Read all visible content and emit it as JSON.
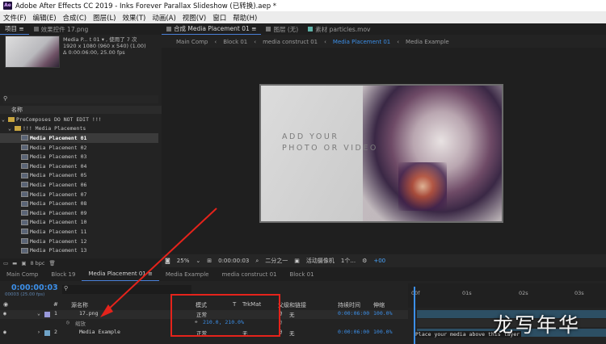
{
  "titlebar": {
    "logo": "Ae",
    "title": "Adobe After Effects CC 2019 - Inks Forever Parallax Slideshow (已转换).aep *"
  },
  "menu": [
    "文件(F)",
    "编辑(E)",
    "合成(C)",
    "图层(L)",
    "效果(T)",
    "动画(A)",
    "视图(V)",
    "窗口",
    "帮助(H)"
  ],
  "project": {
    "tabs": [
      "项目 ≡",
      "效果控件 17.png"
    ],
    "info": [
      "Media P... t 01 ▾ , 使用了 7 次",
      "1920 x 1080 (960 x 540) (1.00)",
      "Δ 0:00:06:00, 25.00 fps"
    ],
    "search": "⚲",
    "col_name": "名称",
    "items": [
      {
        "label": "PreComposes DO NOT EDIT !!!",
        "type": "folder",
        "indent": 0
      },
      {
        "label": "!!! Media Placements",
        "type": "folder",
        "indent": 1
      },
      {
        "label": "Media Placement 01",
        "type": "comp",
        "indent": 2,
        "selected": true
      },
      {
        "label": "Media Placement 02",
        "type": "comp",
        "indent": 2
      },
      {
        "label": "Media Placement 03",
        "type": "comp",
        "indent": 2
      },
      {
        "label": "Media Placement 04",
        "type": "comp",
        "indent": 2
      },
      {
        "label": "Media Placement 05",
        "type": "comp",
        "indent": 2
      },
      {
        "label": "Media Placement 06",
        "type": "comp",
        "indent": 2
      },
      {
        "label": "Media Placement 07",
        "type": "comp",
        "indent": 2
      },
      {
        "label": "Media Placement 08",
        "type": "comp",
        "indent": 2
      },
      {
        "label": "Media Placement 09",
        "type": "comp",
        "indent": 2
      },
      {
        "label": "Media Placement 10",
        "type": "comp",
        "indent": 2
      },
      {
        "label": "Media Placement 11",
        "type": "comp",
        "indent": 2
      },
      {
        "label": "Media Placement 12",
        "type": "comp",
        "indent": 2
      },
      {
        "label": "Media Placement 13",
        "type": "comp",
        "indent": 2
      }
    ],
    "bottom_depth": "8 bpc"
  },
  "composition": {
    "tabs": [
      "合成 Media Placement 01 ≡",
      "图层 (无)",
      "素材 particles.mov"
    ],
    "breadcrumbs": [
      "Main Comp",
      "Block 01",
      "media construct 01",
      "Media Placement 01",
      "Media Example"
    ],
    "placeholder_line1": "ADD YOUR",
    "placeholder_line2": "PHOTO OR VIDEO",
    "toolbar": {
      "zoom": "25%",
      "timecode": "0:00:00:03",
      "resolution": "二分之一",
      "camera": "活动摄像机",
      "views": "1个...",
      "offset": "+00"
    }
  },
  "timeline": {
    "tabs": [
      "Main Comp",
      "Block 19",
      "Media Placement 01 ≡",
      "Media Example",
      "media construct 01",
      "Block 01"
    ],
    "timecode": "0:00:00:03",
    "fps": "00003 (25.00 fps)",
    "columns": {
      "name": "源名称",
      "mode": "模式",
      "t": "T",
      "trkmat": "TrkMat",
      "parent": "父级和链接",
      "duration": "持续时间",
      "stretch": "伸缩"
    },
    "layers": [
      {
        "num": "1",
        "name": "17.png",
        "mode": "正常",
        "parent": "无",
        "duration": "0:00:06:00",
        "stretch": "100.0%",
        "color": "#9a9adb"
      },
      {
        "num": "2",
        "name": "Media Example",
        "mode": "正常",
        "trkmat": "无",
        "parent": "无",
        "duration": "0:00:06:00",
        "stretch": "100.0%",
        "color": "#6fa3c7"
      }
    ],
    "scale_label": "缩放",
    "scale_value": "210.0, 210.0%",
    "ruler_ticks": [
      "00f",
      "01s",
      "02s",
      "03s"
    ],
    "hint": "Place your media above this layer"
  },
  "watermark": "龙写年华"
}
